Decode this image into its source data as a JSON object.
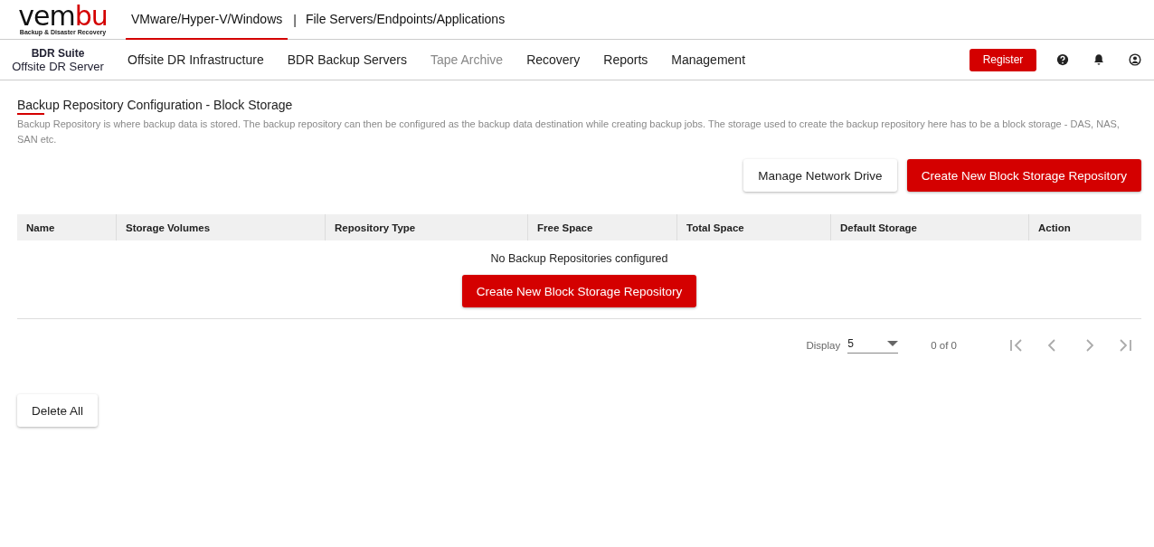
{
  "logo": {
    "word_dark": "vem",
    "word_red": "bu",
    "tagline": "Backup & Disaster Recovery"
  },
  "product_tabs": [
    {
      "label": "VMware/Hyper-V/Windows",
      "selected": true
    },
    {
      "label": "File Servers/Endpoints/Applications",
      "selected": false
    }
  ],
  "product_separator": "|",
  "suite": {
    "name": "BDR Suite",
    "server": "Offsite DR Server"
  },
  "nav": [
    {
      "label": "Offsite DR Infrastructure",
      "disabled": false
    },
    {
      "label": "BDR Backup Servers",
      "disabled": false
    },
    {
      "label": "Tape Archive",
      "disabled": true
    },
    {
      "label": "Recovery",
      "disabled": false
    },
    {
      "label": "Reports",
      "disabled": false
    },
    {
      "label": "Management",
      "disabled": false
    }
  ],
  "register_button": "Register",
  "page": {
    "title": "Backup Repository Configuration - Block Storage",
    "description": "Backup Repository is where backup data is stored. The backup repository can then be configured as the backup data destination while creating backup jobs. The storage used to create the backup repository here has to be a block storage - DAS, NAS, SAN etc."
  },
  "actions": [
    {
      "label": "Manage Network Drive",
      "kind": "secondary"
    },
    {
      "label": "Create New Block Storage Repository",
      "kind": "primary"
    }
  ],
  "table": {
    "columns": [
      "Name",
      "Storage Volumes",
      "Repository Type",
      "Free Space",
      "Total Space",
      "Default Storage",
      "Action"
    ],
    "empty_message": "No Backup Repositories configured",
    "empty_button": "Create New Block Storage Repository"
  },
  "pager": {
    "display_label": "Display",
    "page_size": "5",
    "count": "0 of 0",
    "buttons": [
      {
        "kind": "first",
        "disabled": true
      },
      {
        "kind": "prev",
        "disabled": true
      },
      {
        "kind": "next",
        "disabled": true
      },
      {
        "kind": "last",
        "disabled": true
      }
    ]
  },
  "delete_all_button": "Delete All"
}
